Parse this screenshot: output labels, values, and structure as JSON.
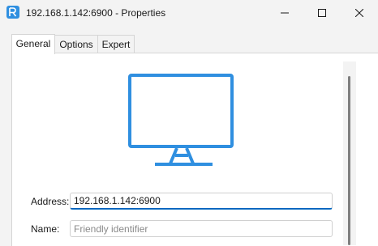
{
  "window": {
    "title": "192.168.1.142:6900 - Properties",
    "icon": "app-logo-icon",
    "accent_color": "#2f8fe0"
  },
  "title_controls": {
    "minimize_icon": "minimize-icon",
    "maximize_icon": "maximize-icon",
    "close_icon": "close-icon"
  },
  "tabs": [
    {
      "label": "General",
      "active": true
    },
    {
      "label": "Options",
      "active": false
    },
    {
      "label": "Expert",
      "active": false
    }
  ],
  "general": {
    "illustration_icon": "monitor-icon",
    "address": {
      "label": "Address:",
      "value": "192.168.1.142:6900"
    },
    "name": {
      "label": "Name:",
      "value": "",
      "placeholder": "Friendly identifier"
    }
  }
}
